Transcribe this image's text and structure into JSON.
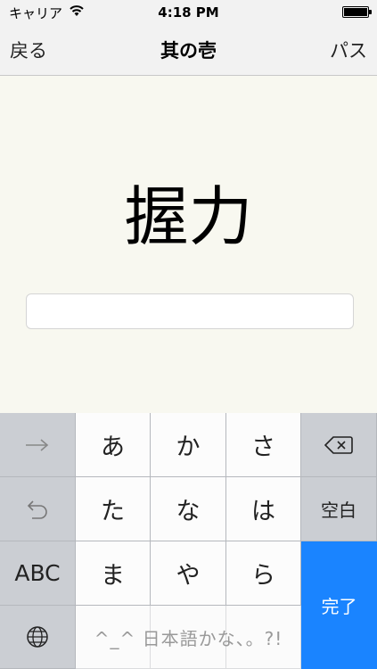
{
  "status": {
    "carrier": "キャリア",
    "time": "4:18 PM"
  },
  "nav": {
    "back": "戻る",
    "title": "其の壱",
    "pass": "パス"
  },
  "quiz": {
    "kanji": "握力",
    "answer_value": ""
  },
  "keyboard": {
    "row1": [
      "あ",
      "か",
      "さ"
    ],
    "row2": [
      "た",
      "な",
      "は"
    ],
    "row3": [
      "ま",
      "や",
      "ら"
    ],
    "abc": "ABC",
    "space": "空白",
    "done": "完了",
    "candidates": "^_^ 日本語かな、。?!"
  },
  "colors": {
    "accent": "#1a84ff",
    "background": "#f8f8f0"
  }
}
